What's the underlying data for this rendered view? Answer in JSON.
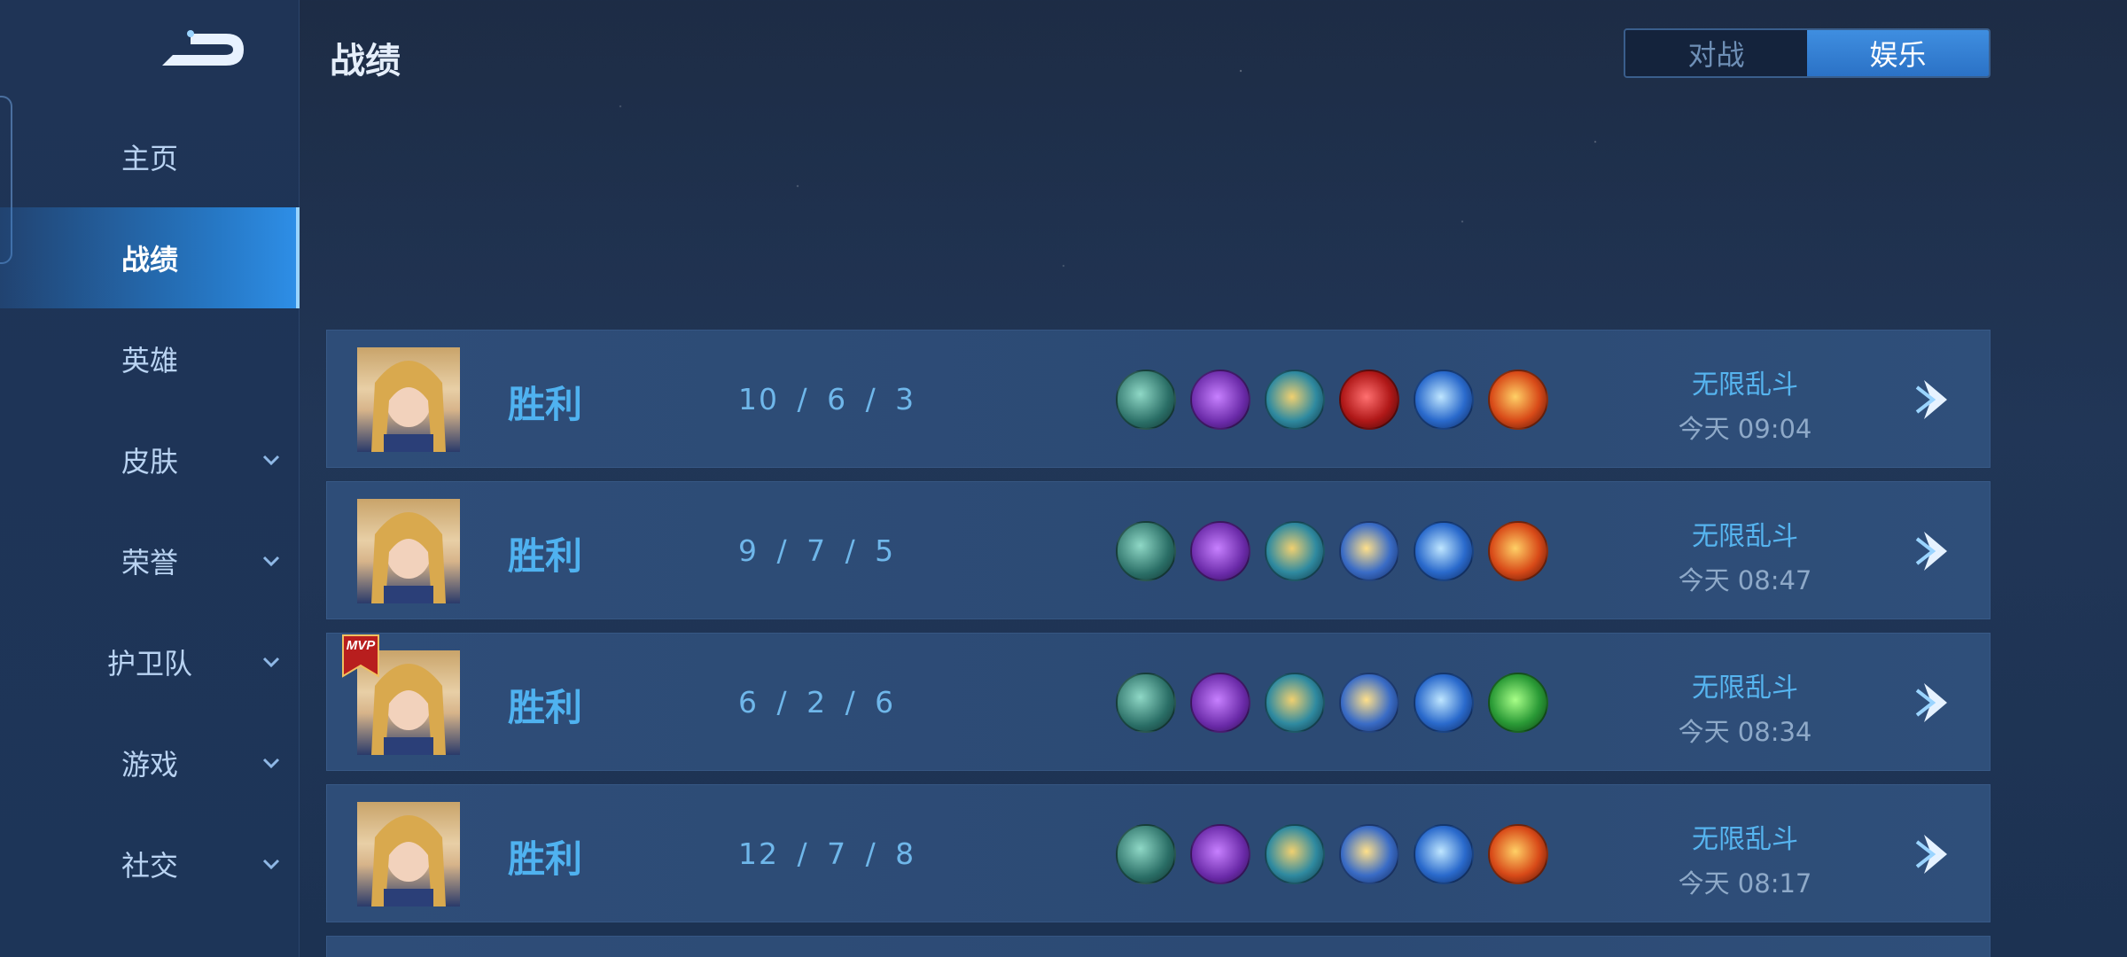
{
  "header": {
    "title": "战绩"
  },
  "mode_tabs": [
    {
      "label": "对战",
      "selected": false
    },
    {
      "label": "娱乐",
      "selected": true
    }
  ],
  "sidebar": {
    "items": [
      {
        "label": "主页",
        "active": false,
        "expandable": false
      },
      {
        "label": "战绩",
        "active": true,
        "expandable": false
      },
      {
        "label": "英雄",
        "active": false,
        "expandable": false
      },
      {
        "label": "皮肤",
        "active": false,
        "expandable": true
      },
      {
        "label": "荣誉",
        "active": false,
        "expandable": true
      },
      {
        "label": "护卫队",
        "active": false,
        "expandable": true
      },
      {
        "label": "游戏",
        "active": false,
        "expandable": true
      },
      {
        "label": "社交",
        "active": false,
        "expandable": true
      }
    ]
  },
  "matches": [
    {
      "result": "胜利",
      "kda": "10 / 6 / 3",
      "mvp": false,
      "items": [
        "boots-icon",
        "axe-icon",
        "trident-icon",
        "red-armor-icon",
        "blade-icon",
        "fire-orb-icon"
      ],
      "mode": "无限乱斗",
      "time": "今天 09:04"
    },
    {
      "result": "胜利",
      "kda": "9 / 7 / 5",
      "mvp": false,
      "items": [
        "boots-icon",
        "axe-icon",
        "trident-icon",
        "golden-wings-icon",
        "blade-icon",
        "fire-orb-icon"
      ],
      "mode": "无限乱斗",
      "time": "今天 08:47"
    },
    {
      "result": "胜利",
      "kda": "6 / 2 / 6",
      "mvp": true,
      "mvp_label": "MVP",
      "items": [
        "boots-icon",
        "axe-icon",
        "trident-icon",
        "golden-wings-icon",
        "blade-icon",
        "green-gem-icon"
      ],
      "mode": "无限乱斗",
      "time": "今天 08:34"
    },
    {
      "result": "胜利",
      "kda": "12 / 7 / 8",
      "mvp": false,
      "items": [
        "boots-icon",
        "axe-icon",
        "trident-icon",
        "golden-wings-icon",
        "blade-icon",
        "fire-orb-icon"
      ],
      "mode": "无限乱斗",
      "time": "今天 08:17"
    }
  ],
  "colors": {
    "accent": "#2e8fe8",
    "result_win": "#4fb2f0",
    "mode_text": "#56b4ef"
  }
}
